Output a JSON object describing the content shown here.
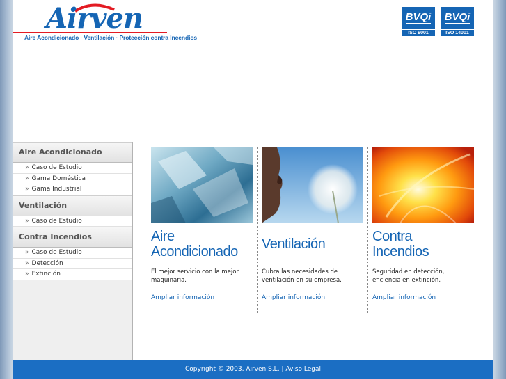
{
  "header": {
    "logo_text": "Airven",
    "tagline": "Aire Acondicionado · Ventilación · Protección contra Incendios",
    "certs": [
      {
        "mark": "BVQi",
        "label": "ISO 9001"
      },
      {
        "mark": "BVQi",
        "label": "ISO 14001"
      }
    ]
  },
  "sidebar": {
    "sections": [
      {
        "title": "Aire Acondicionado",
        "items": [
          "Caso de Estudio",
          "Gama Doméstica",
          "Gama Industrial"
        ]
      },
      {
        "title": "Ventilación",
        "items": [
          "Caso de Estudio"
        ]
      },
      {
        "title": "Contra Incendios",
        "items": [
          "Caso de Estudio",
          "Detección",
          "Extinción"
        ]
      }
    ],
    "arrow": "»"
  },
  "columns": [
    {
      "title_line1": "Aire",
      "title_line2": "Acondicionado",
      "desc": "El mejor servicio con la mejor maquinaria.",
      "link": "Ampliar información",
      "image": "ice-photo"
    },
    {
      "title_line1": "Ventilación",
      "title_line2": "",
      "desc": "Cubra las necesidades de ventilación en su empresa.",
      "link": "Ampliar información",
      "image": "dandelion-photo"
    },
    {
      "title_line1": "Contra",
      "title_line2": "Incendios",
      "desc": "Seguridad en detección, eficiencia en extinción.",
      "link": "Ampliar información",
      "image": "fire-photo"
    }
  ],
  "footer": {
    "copyright": "Copyright © 2003, Airven S.L.",
    "separator": "|",
    "legal": "Aviso Legal"
  },
  "colors": {
    "brand_blue": "#1565b4",
    "brand_red": "#e31b23",
    "footer_blue": "#1b6ec3"
  }
}
